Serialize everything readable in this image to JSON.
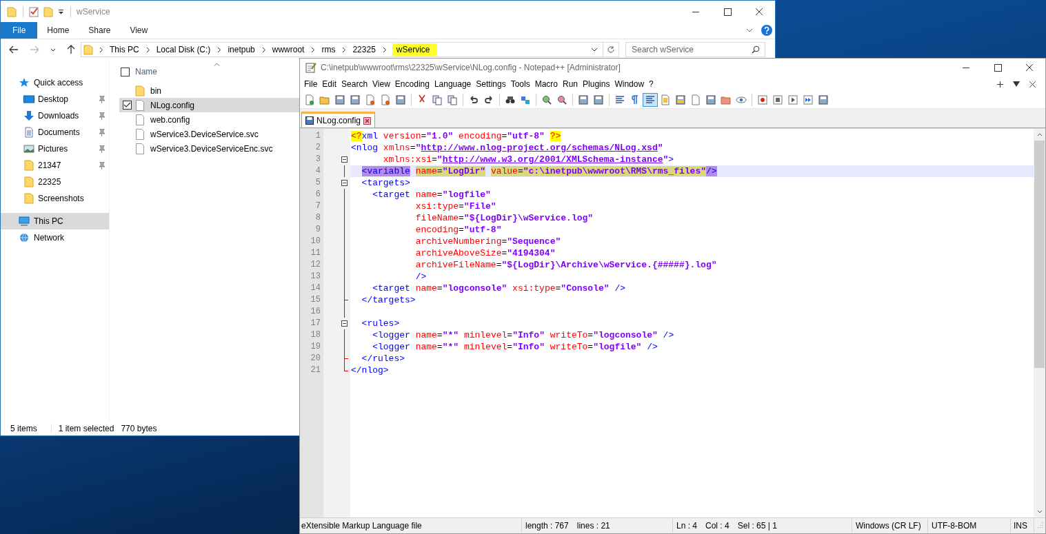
{
  "explorer": {
    "title": "wService",
    "ribbon_tabs": [
      {
        "label": "File",
        "selected": true
      },
      {
        "label": "Home",
        "selected": false
      },
      {
        "label": "Share",
        "selected": false
      },
      {
        "label": "View",
        "selected": false
      }
    ],
    "breadcrumbs": [
      {
        "label": "This PC",
        "highlighted": false
      },
      {
        "label": "Local Disk (C:)",
        "highlighted": false
      },
      {
        "label": "inetpub",
        "highlighted": false
      },
      {
        "label": "wwwroot",
        "highlighted": false
      },
      {
        "label": "rms",
        "highlighted": false
      },
      {
        "label": "22325",
        "highlighted": false
      },
      {
        "label": "wService",
        "highlighted": true
      }
    ],
    "search": {
      "placeholder": "Search wService"
    },
    "nav": [
      {
        "label": "Quick access",
        "kind": "star",
        "selected": false,
        "children": [
          {
            "label": "Desktop",
            "kind": "desktop",
            "pinned": true,
            "selected": false
          },
          {
            "label": "Downloads",
            "kind": "download",
            "pinned": true,
            "selected": false
          },
          {
            "label": "Documents",
            "kind": "documents",
            "pinned": true,
            "selected": false
          },
          {
            "label": "Pictures",
            "kind": "pictures",
            "pinned": true,
            "selected": false
          },
          {
            "label": "21347",
            "kind": "folder",
            "pinned": true,
            "selected": false
          },
          {
            "label": "22325",
            "kind": "folder",
            "pinned": false,
            "selected": false
          },
          {
            "label": "Screenshots",
            "kind": "folder",
            "pinned": false,
            "selected": false
          }
        ]
      },
      {
        "label": "This PC",
        "kind": "pc",
        "selected": true
      },
      {
        "label": "Network",
        "kind": "network",
        "selected": false
      }
    ],
    "columns": [
      {
        "label": "Name"
      }
    ],
    "select_all_checked": false,
    "files": [
      {
        "name": "bin",
        "kind": "folder",
        "selected": false
      },
      {
        "name": "NLog.config",
        "kind": "file",
        "selected": true
      },
      {
        "name": "web.config",
        "kind": "file",
        "selected": false
      },
      {
        "name": "wService3.DeviceService.svc",
        "kind": "file",
        "selected": false
      },
      {
        "name": "wService3.DeviceServiceEnc.svc",
        "kind": "file",
        "selected": false
      }
    ],
    "status_bar": [
      "5 items",
      "1 item selected",
      "770 bytes"
    ]
  },
  "notepad": {
    "title": "C:\\inetpub\\wwwroot\\rms\\22325\\wService\\NLog.config - Notepad++ [Administrator]",
    "menu": [
      "File",
      "Edit",
      "Search",
      "View",
      "Encoding",
      "Language",
      "Settings",
      "Tools",
      "Macro",
      "Run",
      "Plugins",
      "Window",
      "?"
    ],
    "toolbar_groups": [
      [
        {
          "pressed": false
        },
        {
          "pressed": false
        },
        {
          "pressed": false
        },
        {
          "pressed": false
        },
        {
          "pressed": false
        },
        {
          "pressed": false
        },
        {
          "pressed": false
        }
      ],
      [
        {
          "pressed": false
        },
        {
          "pressed": false
        },
        {
          "pressed": false
        }
      ],
      [
        {
          "pressed": false
        },
        {
          "pressed": false
        }
      ],
      [
        {
          "pressed": false
        },
        {
          "pressed": false
        }
      ],
      [
        {
          "pressed": false
        },
        {
          "pressed": false
        }
      ],
      [
        {
          "pressed": false
        },
        {
          "pressed": false
        }
      ],
      [
        {
          "pressed": false
        },
        {
          "pressed": false
        },
        {
          "pressed": true
        },
        {
          "pressed": false
        },
        {
          "pressed": false
        },
        {
          "pressed": false
        },
        {
          "pressed": false
        },
        {
          "pressed": false
        },
        {
          "pressed": false
        }
      ],
      [
        {
          "pressed": false
        },
        {
          "pressed": false
        },
        {
          "pressed": false
        },
        {
          "pressed": false
        },
        {
          "pressed": false
        }
      ]
    ],
    "tabs": [
      {
        "label": "NLog.config",
        "selected": true
      }
    ],
    "lines": [
      {
        "number": "1",
        "kind": "none",
        "current": false,
        "tokens": [
          {
            "t": "<?",
            "kind": "pi"
          },
          {
            "t": "xml",
            "kind": "tag"
          },
          {
            "t": " version",
            "kind": "attr"
          },
          {
            "t": "=",
            "kind": "eq"
          },
          {
            "t": "\"1.0\"",
            "kind": "str"
          },
          {
            "t": " encoding",
            "kind": "attr"
          },
          {
            "t": "=",
            "kind": "eq"
          },
          {
            "t": "\"utf-8\"",
            "kind": "str"
          },
          {
            "t": " ?>",
            "kind": "pi"
          }
        ]
      },
      {
        "number": "2",
        "kind": "none",
        "current": false,
        "tokens": [
          {
            "t": "<nlog",
            "kind": "tag"
          },
          {
            "t": " xmlns",
            "kind": "attr"
          },
          {
            "t": "=",
            "kind": "eq"
          },
          {
            "t": "\"",
            "kind": "str"
          },
          {
            "t": "http://www.nlog-project.org/schemas/NLog.xsd",
            "kind": "url"
          },
          {
            "t": "\"",
            "kind": "str"
          }
        ]
      },
      {
        "number": "3",
        "kind": "start",
        "current": false,
        "tokens": [
          {
            "t": "      xmlns:xsi",
            "kind": "attr"
          },
          {
            "t": "=",
            "kind": "eq"
          },
          {
            "t": "\"",
            "kind": "str"
          },
          {
            "t": "http://www.w3.org/2001/XMLSchema-instance",
            "kind": "url"
          },
          {
            "t": "\"",
            "kind": "str"
          },
          {
            "t": ">",
            "kind": "tag"
          }
        ]
      },
      {
        "number": "4",
        "kind": "body",
        "current": true,
        "tokens": [
          {
            "t": "  <variable",
            "kind": "mtag"
          },
          {
            "t": " name",
            "kind": "mattr"
          },
          {
            "t": "=",
            "kind": "meq"
          },
          {
            "t": "\"LogDir\"",
            "kind": "mstr"
          },
          {
            "t": " value",
            "kind": "mattr"
          },
          {
            "t": "=",
            "kind": "meq"
          },
          {
            "t": "\"c:\\inetpub\\wwwroot\\RMS\\rms_files\"",
            "kind": "mstr"
          },
          {
            "t": "/>",
            "kind": "mtag"
          }
        ]
      },
      {
        "number": "5",
        "kind": "start",
        "current": false,
        "tokens": [
          {
            "t": "  <targets>",
            "kind": "tag"
          }
        ]
      },
      {
        "number": "6",
        "kind": "body",
        "current": false,
        "tokens": [
          {
            "t": "    <target",
            "kind": "tag"
          },
          {
            "t": " name",
            "kind": "attr"
          },
          {
            "t": "=",
            "kind": "eq"
          },
          {
            "t": "\"logfile\"",
            "kind": "str"
          }
        ]
      },
      {
        "number": "7",
        "kind": "body",
        "current": false,
        "tokens": [
          {
            "t": "            xsi:type",
            "kind": "attr"
          },
          {
            "t": "=",
            "kind": "eq"
          },
          {
            "t": "\"File\"",
            "kind": "str"
          }
        ]
      },
      {
        "number": "8",
        "kind": "body",
        "current": false,
        "tokens": [
          {
            "t": "            fileName",
            "kind": "attr"
          },
          {
            "t": "=",
            "kind": "eq"
          },
          {
            "t": "\"${LogDir}\\wService.log\"",
            "kind": "str"
          }
        ]
      },
      {
        "number": "9",
        "kind": "body",
        "current": false,
        "tokens": [
          {
            "t": "            encoding",
            "kind": "attr"
          },
          {
            "t": "=",
            "kind": "eq"
          },
          {
            "t": "\"utf-8\"",
            "kind": "str"
          }
        ]
      },
      {
        "number": "10",
        "kind": "body",
        "current": false,
        "tokens": [
          {
            "t": "            archiveNumbering",
            "kind": "attr"
          },
          {
            "t": "=",
            "kind": "eq"
          },
          {
            "t": "\"Sequence\"",
            "kind": "str"
          }
        ]
      },
      {
        "number": "11",
        "kind": "body",
        "current": false,
        "tokens": [
          {
            "t": "            archiveAboveSize",
            "kind": "attr"
          },
          {
            "t": "=",
            "kind": "eq"
          },
          {
            "t": "\"4194304\"",
            "kind": "str"
          }
        ]
      },
      {
        "number": "12",
        "kind": "body",
        "current": false,
        "tokens": [
          {
            "t": "            archiveFileName",
            "kind": "attr"
          },
          {
            "t": "=",
            "kind": "eq"
          },
          {
            "t": "\"${LogDir}\\Archive\\wService.{#####}.log\"",
            "kind": "str"
          }
        ]
      },
      {
        "number": "13",
        "kind": "body",
        "current": false,
        "tokens": [
          {
            "t": "            />",
            "kind": "tag"
          }
        ]
      },
      {
        "number": "14",
        "kind": "body",
        "current": false,
        "tokens": [
          {
            "t": "    <target",
            "kind": "tag"
          },
          {
            "t": " name",
            "kind": "attr"
          },
          {
            "t": "=",
            "kind": "eq"
          },
          {
            "t": "\"logconsole\"",
            "kind": "str"
          },
          {
            "t": " xsi:type",
            "kind": "attr"
          },
          {
            "t": "=",
            "kind": "eq"
          },
          {
            "t": "\"Console\"",
            "kind": "str"
          },
          {
            "t": " />",
            "kind": "tag"
          }
        ]
      },
      {
        "number": "15",
        "kind": "end",
        "current": false,
        "tokens": [
          {
            "t": "  </targets>",
            "kind": "tag"
          }
        ]
      },
      {
        "number": "16",
        "kind": "body",
        "current": false
      },
      {
        "number": "17",
        "kind": "start",
        "current": false,
        "tokens": [
          {
            "t": "  <rules>",
            "kind": "tag"
          }
        ]
      },
      {
        "number": "18",
        "kind": "body",
        "current": false,
        "tokens": [
          {
            "t": "    <logger",
            "kind": "tag"
          },
          {
            "t": " name",
            "kind": "attr"
          },
          {
            "t": "=",
            "kind": "eq"
          },
          {
            "t": "\"*\"",
            "kind": "str"
          },
          {
            "t": " minlevel",
            "kind": "attr"
          },
          {
            "t": "=",
            "kind": "eq"
          },
          {
            "t": "\"Info\"",
            "kind": "str"
          },
          {
            "t": " writeTo",
            "kind": "attr"
          },
          {
            "t": "=",
            "kind": "eq"
          },
          {
            "t": "\"logconsole\"",
            "kind": "str"
          },
          {
            "t": " />",
            "kind": "tag"
          }
        ]
      },
      {
        "number": "19",
        "kind": "body",
        "current": false,
        "tokens": [
          {
            "t": "    <logger",
            "kind": "tag"
          },
          {
            "t": " name",
            "kind": "attr"
          },
          {
            "t": "=",
            "kind": "eq"
          },
          {
            "t": "\"*\"",
            "kind": "str"
          },
          {
            "t": " minlevel",
            "kind": "attr"
          },
          {
            "t": "=",
            "kind": "eq"
          },
          {
            "t": "\"Info\"",
            "kind": "str"
          },
          {
            "t": " writeTo",
            "kind": "attr"
          },
          {
            "t": "=",
            "kind": "eq"
          },
          {
            "t": "\"logfile\"",
            "kind": "str"
          },
          {
            "t": " />",
            "kind": "tag"
          }
        ]
      },
      {
        "number": "20",
        "kind": "end",
        "current": false,
        "tokens": [
          {
            "t": "  </rules>",
            "kind": "tag"
          }
        ]
      },
      {
        "number": "21",
        "kind": "last",
        "current": false,
        "tokens": [
          {
            "t": "</nlog>",
            "kind": "tag"
          }
        ]
      }
    ],
    "status_bar": [
      {
        "texts": [
          "eXtensible Markup Language file"
        ]
      },
      {
        "texts": [
          "length : 767",
          "lines : 21"
        ]
      },
      {
        "texts": [
          "Ln : 4",
          "Col : 4",
          "Sel : 65 | 1"
        ]
      },
      {
        "texts": [
          "Windows (CR LF)"
        ]
      },
      {
        "texts": [
          "UTF-8-BOM"
        ]
      },
      {
        "texts": [
          "INS"
        ]
      }
    ]
  }
}
